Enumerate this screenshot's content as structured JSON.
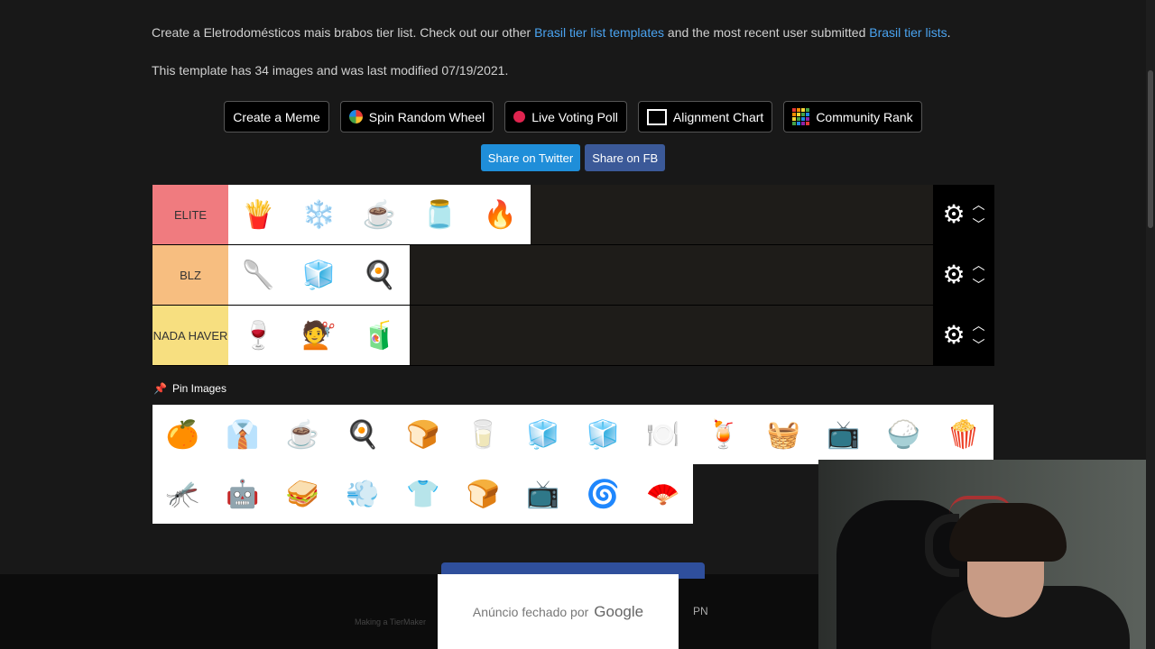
{
  "intro": {
    "pre": "Create a Eletrodomésticos mais brabos tier list. Check out our other ",
    "link1": "Brasil tier list templates",
    "mid": " and the most recent user submitted ",
    "link2": "Brasil tier lists",
    "post": "."
  },
  "meta_text": "This template has 34 images and was last modified 07/19/2021.",
  "buttons": {
    "meme": "Create a Meme",
    "wheel": "Spin Random Wheel",
    "poll": "Live Voting Poll",
    "alignment": "Alignment Chart",
    "community": "Community Rank"
  },
  "share": {
    "twitter": "Share on Twitter",
    "fb": "Share on FB"
  },
  "tiers": [
    {
      "label": "ELITE",
      "color": "#f07b7f",
      "items": [
        "🍟",
        "❄️",
        "☕",
        "🫙",
        "🔥"
      ]
    },
    {
      "label": "BLZ",
      "color": "#f7be80",
      "items": [
        "🥄",
        "🧊",
        "🍳"
      ]
    },
    {
      "label": "NADA HAVER",
      "color": "#f7df80",
      "items": [
        "🍷",
        "💇",
        "🧃"
      ]
    }
  ],
  "pin_label": "Pin Images",
  "pool_items": [
    "🍊",
    "👔",
    "☕",
    "🍳",
    "🍞",
    "🥛",
    "🧊",
    "🧊",
    "🍽️",
    "🍹",
    "🧺",
    "📺",
    "🍚",
    "🍿",
    "🦟",
    "🤖",
    "🥪",
    "💨",
    "👕",
    "🍞",
    "📺",
    "🌀",
    "🪭"
  ],
  "ad": {
    "text": "Anúncio fechado por",
    "brand": "Google"
  },
  "pn": "PN",
  "faint_footer": "Making a TierMaker"
}
